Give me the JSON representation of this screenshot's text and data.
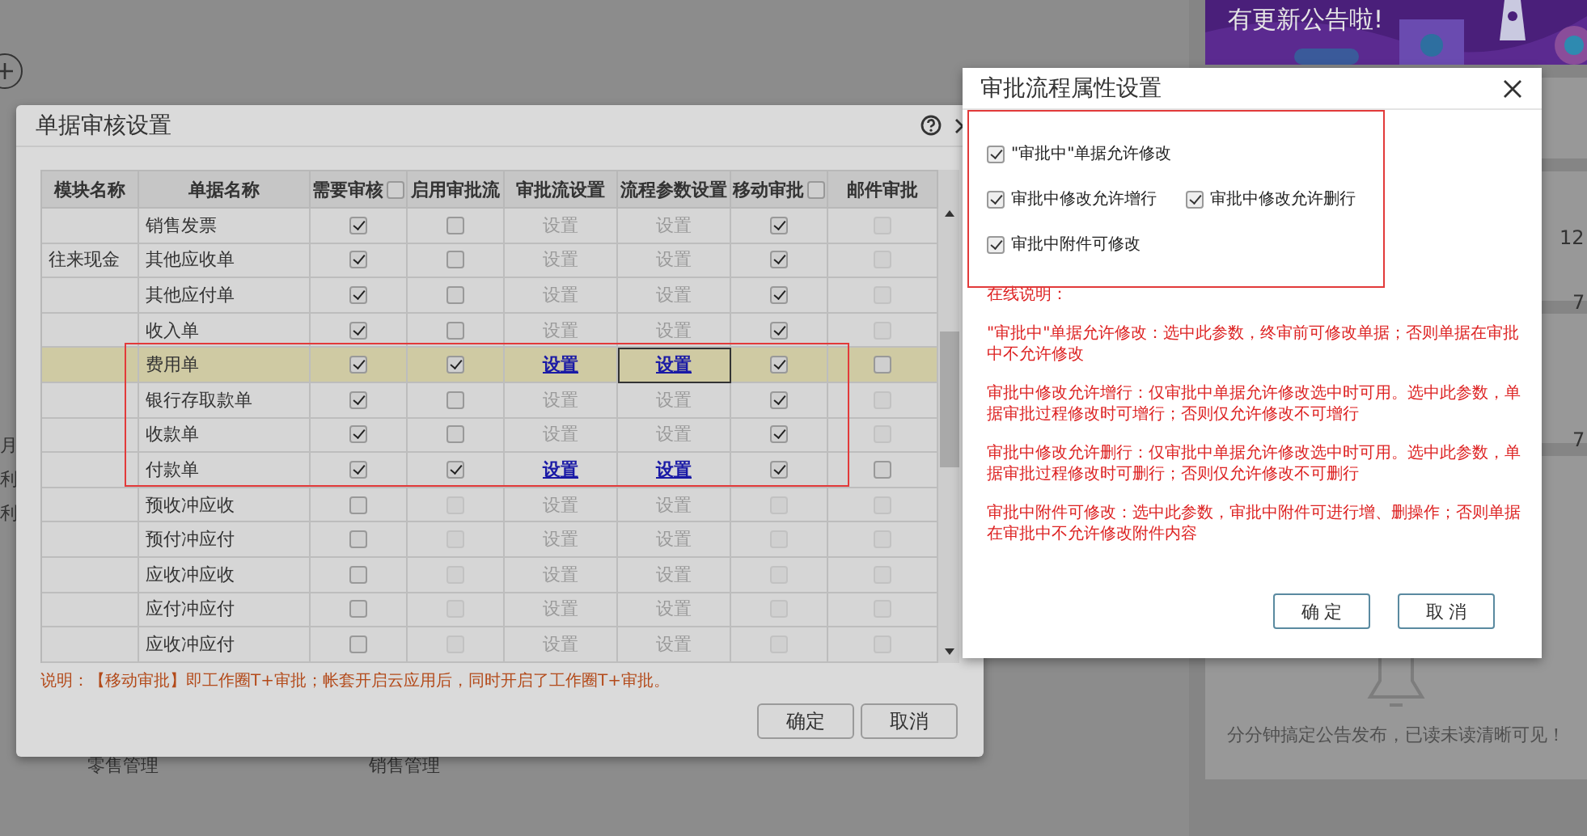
{
  "background": {
    "left_labels": [
      "月",
      "利",
      "利"
    ],
    "bottom_labels": [
      "零售管理",
      "销售管理"
    ],
    "banner": {
      "text": "有更新公告啦!"
    },
    "counts": [
      "12",
      "7",
      "7"
    ],
    "notice": "分分钟搞定公告发布，已读未读清晰可见！"
  },
  "review_dialog": {
    "title": "单据审核设置",
    "columns": [
      {
        "label": "模块名称",
        "kind": "text"
      },
      {
        "label": "单据名称",
        "kind": "text"
      },
      {
        "label": "需要审核",
        "kind": "check",
        "checked": false
      },
      {
        "label": "启用审批流",
        "kind": "text"
      },
      {
        "label": "审批流设置",
        "kind": "text"
      },
      {
        "label": "流程参数设置",
        "kind": "text"
      },
      {
        "label": "移动审批",
        "kind": "check",
        "checked": false
      },
      {
        "label": "邮件审批",
        "kind": "text"
      }
    ],
    "rows": [
      {
        "module": "",
        "name": "销售发票",
        "selected": false,
        "need_review": true,
        "enable_flow": false,
        "flow_disabled": false,
        "flow_setting": "设置",
        "param_setting": "设置",
        "links_active": false,
        "mobile": true,
        "mobile_disabled": false,
        "mail": false,
        "mail_disabled": true
      },
      {
        "module": "往来现金",
        "name": "其他应收单",
        "selected": false,
        "need_review": true,
        "enable_flow": false,
        "flow_disabled": false,
        "flow_setting": "设置",
        "param_setting": "设置",
        "links_active": false,
        "mobile": true,
        "mobile_disabled": false,
        "mail": false,
        "mail_disabled": true
      },
      {
        "module": "",
        "name": "其他应付单",
        "selected": false,
        "need_review": true,
        "enable_flow": false,
        "flow_disabled": false,
        "flow_setting": "设置",
        "param_setting": "设置",
        "links_active": false,
        "mobile": true,
        "mobile_disabled": false,
        "mail": false,
        "mail_disabled": true
      },
      {
        "module": "",
        "name": "收入单",
        "selected": false,
        "need_review": true,
        "enable_flow": false,
        "flow_disabled": false,
        "flow_setting": "设置",
        "param_setting": "设置",
        "links_active": false,
        "mobile": true,
        "mobile_disabled": false,
        "mail": false,
        "mail_disabled": true
      },
      {
        "module": "",
        "name": "费用单",
        "selected": true,
        "need_review": true,
        "enable_flow": true,
        "flow_disabled": false,
        "flow_setting": "设置",
        "param_setting": "设置",
        "links_active": true,
        "mobile": true,
        "mobile_disabled": false,
        "mail": false,
        "mail_disabled": false
      },
      {
        "module": "",
        "name": "银行存取款单",
        "selected": false,
        "need_review": true,
        "enable_flow": false,
        "flow_disabled": false,
        "flow_setting": "设置",
        "param_setting": "设置",
        "links_active": false,
        "mobile": true,
        "mobile_disabled": false,
        "mail": false,
        "mail_disabled": true
      },
      {
        "module": "",
        "name": "收款单",
        "selected": false,
        "need_review": true,
        "enable_flow": false,
        "flow_disabled": false,
        "flow_setting": "设置",
        "param_setting": "设置",
        "links_active": false,
        "mobile": true,
        "mobile_disabled": false,
        "mail": false,
        "mail_disabled": true
      },
      {
        "module": "",
        "name": "付款单",
        "selected": false,
        "need_review": true,
        "enable_flow": true,
        "flow_disabled": false,
        "flow_setting": "设置",
        "param_setting": "设置",
        "links_active": true,
        "mobile": true,
        "mobile_disabled": false,
        "mail": false,
        "mail_disabled": false
      },
      {
        "module": "",
        "name": "预收冲应收",
        "selected": false,
        "need_review": false,
        "enable_flow": false,
        "flow_disabled": true,
        "flow_setting": "设置",
        "param_setting": "设置",
        "links_active": false,
        "mobile": false,
        "mobile_disabled": true,
        "mail": false,
        "mail_disabled": true
      },
      {
        "module": "",
        "name": "预付冲应付",
        "selected": false,
        "need_review": false,
        "enable_flow": false,
        "flow_disabled": true,
        "flow_setting": "设置",
        "param_setting": "设置",
        "links_active": false,
        "mobile": false,
        "mobile_disabled": true,
        "mail": false,
        "mail_disabled": true
      },
      {
        "module": "",
        "name": "应收冲应收",
        "selected": false,
        "need_review": false,
        "enable_flow": false,
        "flow_disabled": true,
        "flow_setting": "设置",
        "param_setting": "设置",
        "links_active": false,
        "mobile": false,
        "mobile_disabled": true,
        "mail": false,
        "mail_disabled": true
      },
      {
        "module": "",
        "name": "应付冲应付",
        "selected": false,
        "need_review": false,
        "enable_flow": false,
        "flow_disabled": true,
        "flow_setting": "设置",
        "param_setting": "设置",
        "links_active": false,
        "mobile": false,
        "mobile_disabled": true,
        "mail": false,
        "mail_disabled": true
      },
      {
        "module": "",
        "name": "应收冲应付",
        "selected": false,
        "need_review": false,
        "enable_flow": false,
        "flow_disabled": true,
        "flow_setting": "设置",
        "param_setting": "设置",
        "links_active": false,
        "mobile": false,
        "mobile_disabled": true,
        "mail": false,
        "mail_disabled": true
      }
    ],
    "note": "说明：【移动审批】即工作圈T+审批；帐套开启云应用后，同时开启了工作圈T+审批。",
    "buttons": [
      "确定",
      "取消"
    ]
  },
  "flow_dialog": {
    "title": "审批流程属性设置",
    "option_rows": [
      [
        {
          "label": "\"审批中\"单据允许修改",
          "checked": true
        }
      ],
      [
        {
          "label": "审批中修改允许增行",
          "checked": true
        },
        {
          "label": "审批中修改允许删行",
          "checked": true
        }
      ],
      [
        {
          "label": "审批中附件可修改",
          "checked": true
        }
      ]
    ],
    "help_title": "在线说明：",
    "help_paragraphs": [
      "\"审批中\"单据允许修改：选中此参数，终审前可修改单据；否则单据在审批中不允许修改",
      "审批中修改允许增行：仅审批中单据允许修改选中时可用。选中此参数，单据审批过程修改时可增行；否则仅允许修改不可增行",
      "审批中修改允许删行：仅审批中单据允许修改选中时可用。选中此参数，单据审批过程修改时可删行；否则仅允许修改不可删行",
      "审批中附件可修改：选中此参数，审批中附件可进行增、删操作；否则单据在审批中不允许修改附件内容"
    ],
    "buttons": [
      "确 定",
      "取 消"
    ]
  }
}
